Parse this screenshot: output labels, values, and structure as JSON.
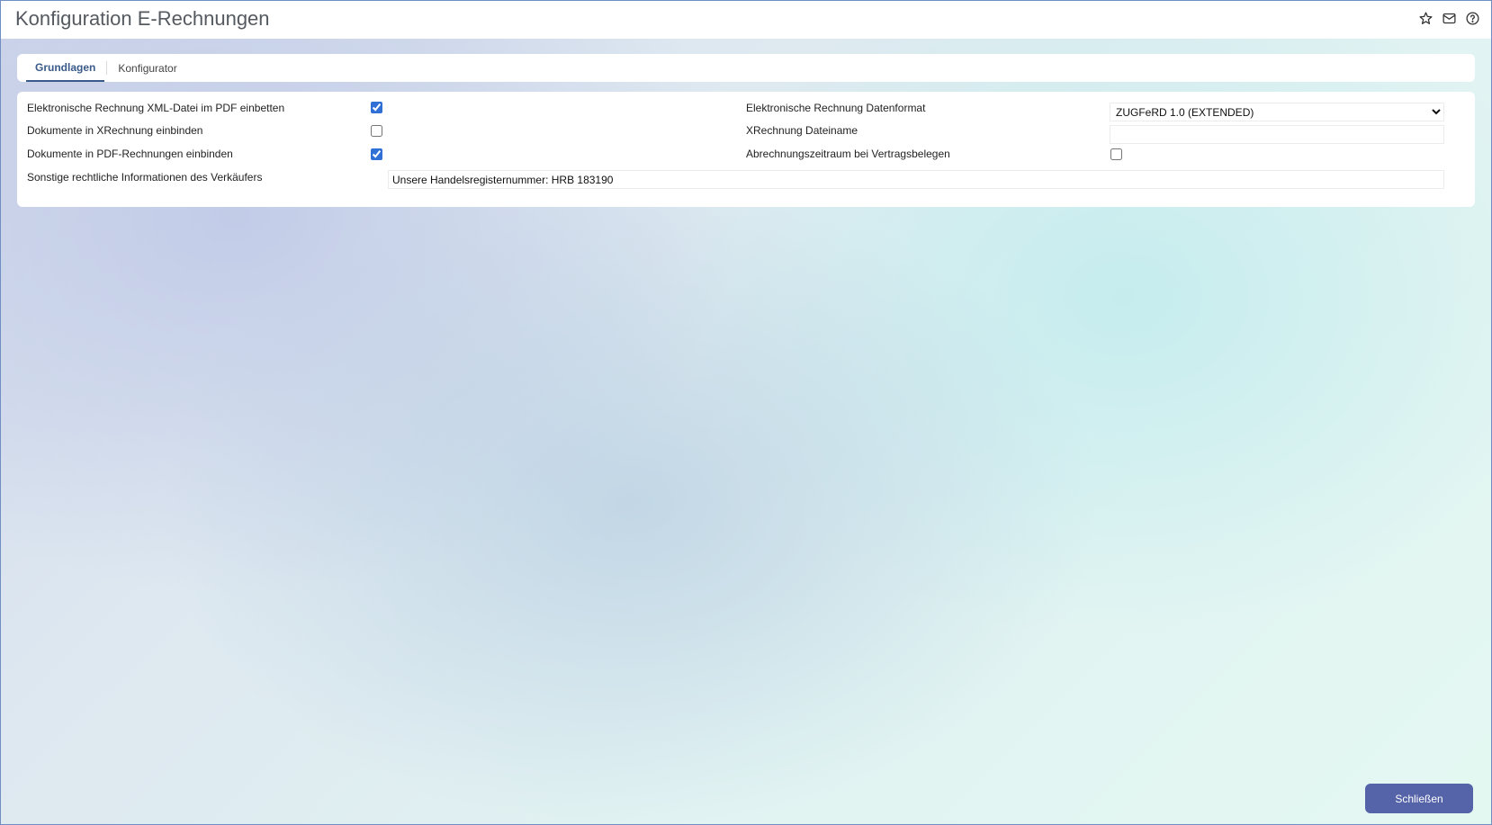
{
  "header": {
    "title": "Konfiguration E-Rechnungen",
    "icons": [
      "star-icon",
      "mail-icon",
      "help-icon"
    ]
  },
  "tabs": [
    {
      "label": "Grundlagen",
      "active": true
    },
    {
      "label": "Konfigurator",
      "active": false
    }
  ],
  "form": {
    "embed_xml_label": "Elektronische Rechnung XML-Datei im PDF einbetten",
    "embed_xml_checked": true,
    "xrechnung_docs_label": "Dokumente in XRechnung einbinden",
    "xrechnung_docs_checked": false,
    "pdf_docs_label": "Dokumente in PDF-Rechnungen einbinden",
    "pdf_docs_checked": true,
    "legal_info_label": "Sonstige rechtliche Informationen des Verkäufers",
    "legal_info_value": "Unsere Handelsregisternummer: HRB 183190",
    "data_format_label": "Elektronische Rechnung Datenformat",
    "data_format_value": "ZUGFeRD 1.0 (EXTENDED)",
    "filename_label": "XRechnung Dateiname",
    "filename_value": "",
    "billing_period_label": "Abrechnungszeitraum bei Vertragsbelegen",
    "billing_period_checked": false
  },
  "footer": {
    "close_label": "Schließen"
  },
  "colors": {
    "accent": "#5563a8",
    "tab_active": "#3a5a8a",
    "checkbox": "#2f6fd6"
  }
}
